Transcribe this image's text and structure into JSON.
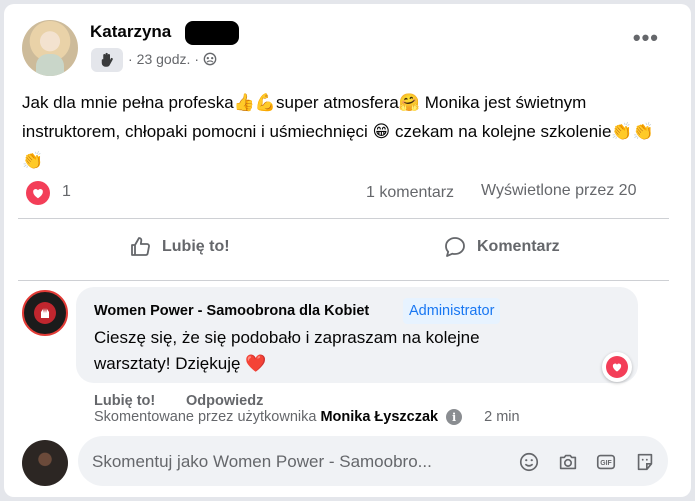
{
  "post": {
    "author": "Katarzyna",
    "time": "23 godz.",
    "separator": "·",
    "text_parts": [
      "Jak dla mnie pełna profeska",
      "👍💪",
      "super atmosfera",
      "🤗",
      " Monika jest świetnym instruktorem, chłopaki pomocni i uśmiechnięci ",
      "😁",
      " czekam na kolejne szkolenie",
      "👏👏👏"
    ],
    "reaction_count": "1",
    "comment_count": "1 komentarz",
    "views": "Wyświetlone przez 20"
  },
  "actions": {
    "like": "Lubię to!",
    "comment": "Komentarz"
  },
  "comment": {
    "author": "Women Power - Samoobrona dla Kobiet",
    "role_tag": "Administrator",
    "text": "Cieszę się, że się podobało i zapraszam na kolejne warsztaty! Dziękuję ",
    "emoji": "❤️",
    "like": "Lubię to!",
    "reply": "Odpowiedz",
    "by_prefix": "Skomentowane przez użytkownika",
    "by_user": "Monika Łyszczak",
    "time": "2 min"
  },
  "composer": {
    "placeholder": "Skomentuj jako Women Power - Samoobro..."
  },
  "colors": {
    "reaction_red": "#f33e58",
    "admin_blue": "#1877f2",
    "muted": "#65676b"
  }
}
